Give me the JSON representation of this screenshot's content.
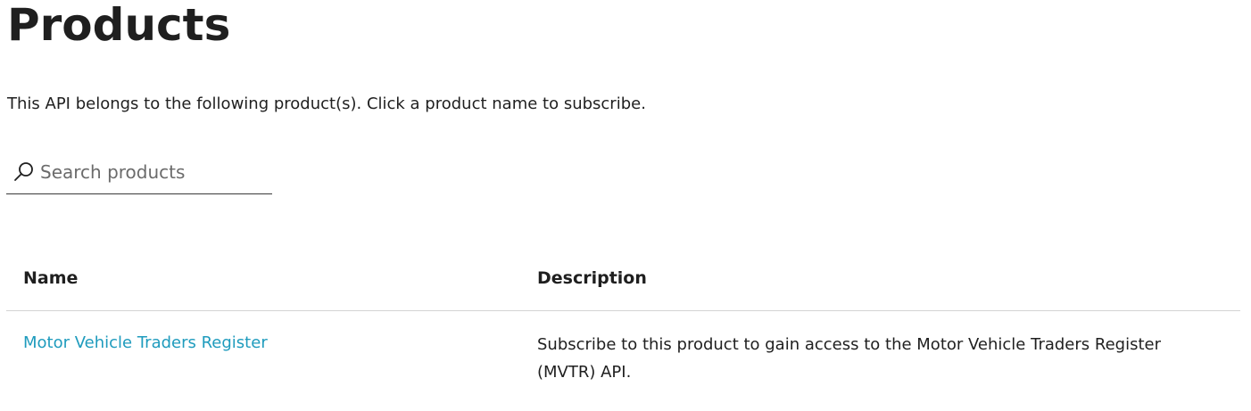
{
  "page": {
    "title": "Products",
    "intro": "This API belongs to the following product(s). Click a product name to subscribe."
  },
  "search": {
    "placeholder": "Search products",
    "value": "",
    "icon": "search-icon"
  },
  "table": {
    "columns": [
      "Name",
      "Description"
    ],
    "rows": [
      {
        "name": "Motor Vehicle Traders Register",
        "description": "Subscribe to this product to gain access to the Motor Vehicle Traders Register (MVTR) API."
      }
    ]
  },
  "colors": {
    "link": "#1e9bbd",
    "text": "#1f1f1f",
    "divider": "#d4d4d4"
  }
}
